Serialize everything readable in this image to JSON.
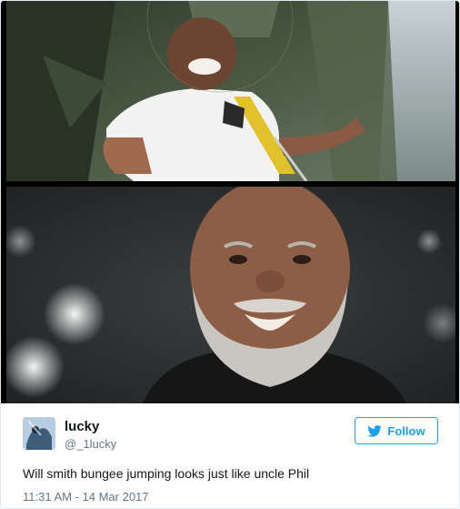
{
  "tweet": {
    "user": {
      "name": "lucky",
      "handle": "@_1lucky"
    },
    "follow_label": "Follow",
    "text": "Will smith bungee jumping looks just like uncle Phil",
    "timestamp": "11:31 AM - 14 Mar 2017"
  },
  "colors": {
    "accent": "#1da1f2",
    "text": "#14171a",
    "muted": "#657786",
    "border": "#e1e8ed"
  },
  "icons": {
    "follow": "twitter-bird-icon"
  }
}
